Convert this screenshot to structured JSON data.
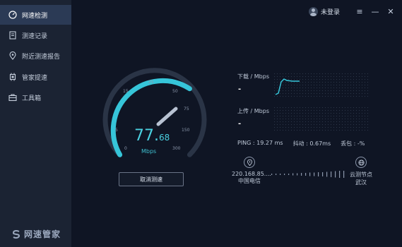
{
  "sidebar": {
    "items": [
      {
        "label": "网速检测",
        "icon": "speedometer-icon",
        "active": true
      },
      {
        "label": "测速记录",
        "icon": "document-icon",
        "active": false
      },
      {
        "label": "附近测速报告",
        "icon": "location-pin-icon",
        "active": false
      },
      {
        "label": "管家提速",
        "icon": "chip-icon",
        "active": false
      },
      {
        "label": "工具箱",
        "icon": "toolbox-icon",
        "active": false
      }
    ],
    "brand": "网速管家"
  },
  "topbar": {
    "user_label": "未登录",
    "menu_icon": "≡",
    "minimize_icon": "—",
    "close_icon": "✕"
  },
  "gauge": {
    "ticks": [
      "0",
      "5",
      "15",
      "25",
      "50",
      "75",
      "150",
      "300"
    ],
    "speed_int": "77.",
    "speed_frac": "68",
    "unit": "Mbps",
    "accent": "#36c5d9"
  },
  "cancel_button": "取消测速",
  "download": {
    "label": "下载 / Mbps",
    "value": "-"
  },
  "upload": {
    "label": "上传 / Mbps",
    "value": "-"
  },
  "stats": {
    "ping": "PING : 19.27 ms",
    "jitter": "抖动 : 0.67ms",
    "loss": "丢包 : -%"
  },
  "nodes": {
    "local_ip": "220.168.85....",
    "local_isp": "中国电信",
    "remote_label": "云测节点",
    "remote_city": "武汉"
  }
}
